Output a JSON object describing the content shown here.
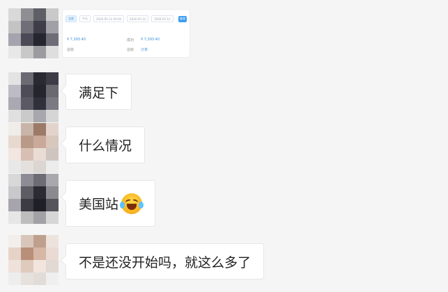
{
  "screenshot_card": {
    "tabs": [
      "全部",
      "今天",
      "2020-05-12 00:00",
      "2020-05-12",
      "2020-05-12"
    ],
    "search_label": "查询",
    "row1_left": "¥ 7,393.40",
    "row1_mid_label": "成功",
    "row1_mid_value": "¥ 7,393.40",
    "row2_left": "总收",
    "row2_mid_label": "总收",
    "row2_mid_value": "订单"
  },
  "messages": [
    {
      "text": "满足下"
    },
    {
      "text": "什么情况"
    },
    {
      "text": "美国站",
      "emoji": "rolling-on-floor-laughing-emoji"
    },
    {
      "text": "不是还没开始吗，就这么多了"
    }
  ],
  "avatar_colors": {
    "a1": [
      "#d9d9d9",
      "#8e8e93",
      "#5e5e66",
      "#c9c9c9",
      "#c4c4c4",
      "#706f78",
      "#3f3e48",
      "#a0a0a6",
      "#a5a3ad",
      "#4b4a56",
      "#252630",
      "#6e6d77",
      "#e8e8e8",
      "#c8c8c8",
      "#9b9ba0",
      "#dedede"
    ],
    "a2": [
      "#e3e3e3",
      "#6c6a73",
      "#2a2a33",
      "#3e3d47",
      "#bdbbc3",
      "#4e4c57",
      "#25252d",
      "#6a6970",
      "#aaa8b0",
      "#5a5964",
      "#30303a",
      "#7b7a82",
      "#e0e0e0",
      "#cacaca",
      "#a7a7ad",
      "#d5d5d5"
    ],
    "a3": [
      "#f0ece9",
      "#c8b4a8",
      "#9c7a68",
      "#e2d4cc",
      "#e7d9d0",
      "#b99a88",
      "#c9a99a",
      "#d8c7bd",
      "#f1e6e0",
      "#d7c0b3",
      "#e9dcd5",
      "#cfc5c0",
      "#e8e8e8",
      "#e4e0dd",
      "#dcd6d2",
      "#ececec"
    ],
    "a4": [
      "#d8d8d8",
      "#8d8b93",
      "#6d6b73",
      "#a9a9ad",
      "#c9c9cc",
      "#5d5b63",
      "#2c2b33",
      "#8a8a8f",
      "#a7a5ab",
      "#3c3b44",
      "#1f1f28",
      "#55545b",
      "#e6e6e6",
      "#bdbdbd",
      "#a2a2a6",
      "#d6d6d6"
    ],
    "a5": [
      "#f2eeeb",
      "#d9c6bb",
      "#bfa08e",
      "#ede3dd",
      "#e6d3c8",
      "#b98f79",
      "#d6b6a5",
      "#e9dbd3",
      "#efe2da",
      "#dfcabe",
      "#f1e5de",
      "#e2d9d4",
      "#ededed",
      "#e7e1de",
      "#e2dcd8",
      "#efefef"
    ]
  }
}
